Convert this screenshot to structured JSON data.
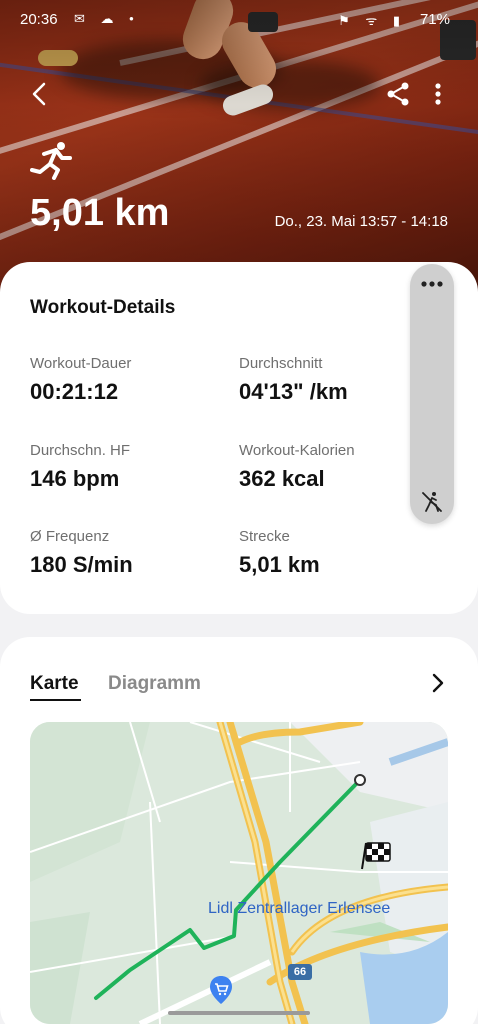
{
  "status_bar": {
    "time": "20:36",
    "battery": "71%"
  },
  "header": {
    "distance": "5,01 km",
    "datetime": "Do., 23. Mai 13:57 - 14:18",
    "icons": [
      "back-icon",
      "share-icon",
      "more-vert-icon",
      "running-icon"
    ]
  },
  "details": {
    "title": "Workout-Details",
    "metrics": [
      {
        "label": "Workout-Dauer",
        "value": "00:21:12"
      },
      {
        "label": "Durchschnitt",
        "value": "04'13\" /km"
      },
      {
        "label": "Durchschn. HF",
        "value": "146 bpm"
      },
      {
        "label": "Workout-Kalorien",
        "value": "362 kcal"
      },
      {
        "label": "Ø Frequenz",
        "value": "180 S/min"
      },
      {
        "label": "Strecke",
        "value": "5,01 km"
      }
    ]
  },
  "tabs": {
    "map": "Karte",
    "diagram": "Diagramm",
    "selected": "Karte"
  },
  "map": {
    "place_label": "Lidl Zentrallager Erlensee",
    "road_shield": "66",
    "route_color": "#1fb35a"
  },
  "colors": {
    "accent": "#1fb35a",
    "hero": "#9a3218"
  }
}
